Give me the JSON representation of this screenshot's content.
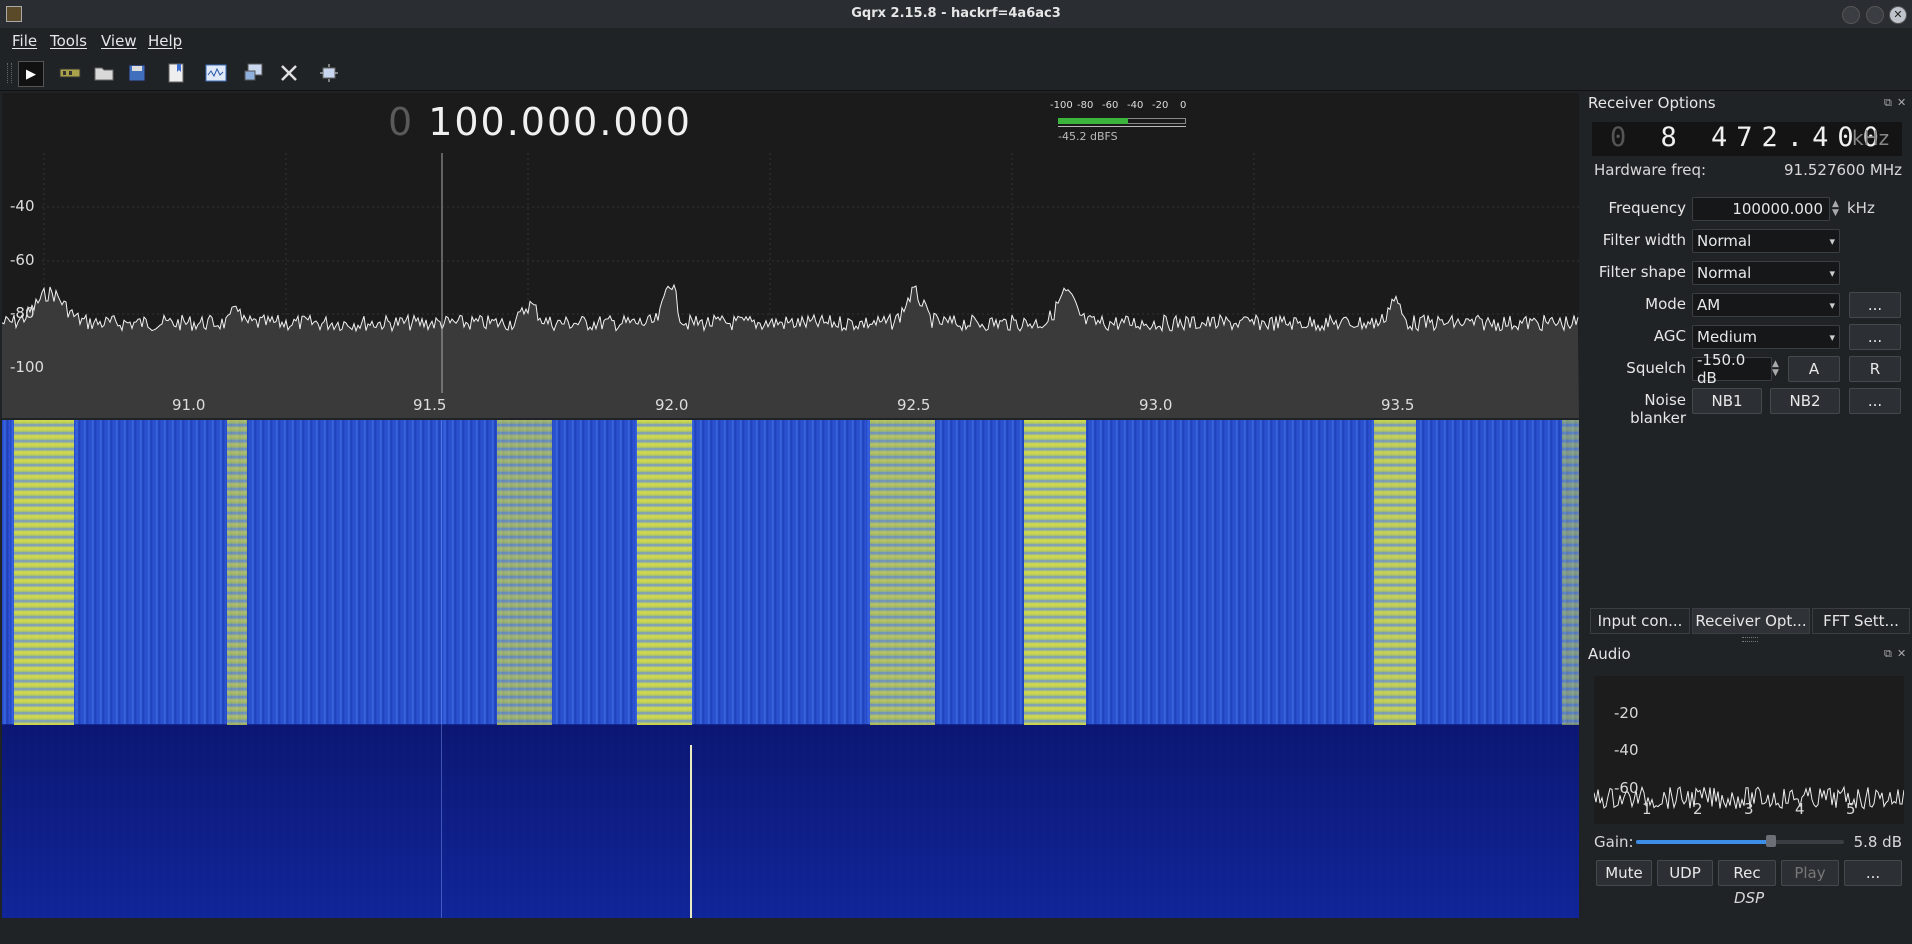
{
  "window": {
    "title": "Gqrx 2.15.8 - hackrf=4a6ac3",
    "close_glyph": "✕"
  },
  "menu": [
    "File",
    "Tools",
    "View",
    "Help"
  ],
  "toolbar": {
    "play_glyph": "▶",
    "icons": [
      "play-icon",
      "hardware-icon",
      "open-icon",
      "save-icon",
      "bookmark-icon",
      "fft-icon",
      "remote-icon",
      "settings-icon",
      "fullscreen-icon"
    ]
  },
  "plot": {
    "freq_lead": "0",
    "freq_main": "100.000.000",
    "y_labels": [
      "-40",
      "-60",
      "-80",
      "-100"
    ],
    "x_labels": [
      "91.0",
      "91.5",
      "92.0",
      "92.5",
      "93.0",
      "93.5"
    ],
    "meter_ticks": [
      "-100",
      "-80",
      "-60",
      "-40",
      "-20",
      "0"
    ],
    "meter_readout": "-45.2 dBFS",
    "meter_level": -45.2
  },
  "receiver": {
    "title": "Receiver Options",
    "float_glyph": "⧉",
    "close_glyph": "✕",
    "lcd_lead": "0",
    "lcd_digits": "8 472.400",
    "lcd_unit": "kHz",
    "hw_freq_label": "Hardware freq:",
    "hw_freq_value": "91.527600 MHz",
    "frequency_label": "Frequency",
    "frequency_value": "100000.000",
    "frequency_unit": "kHz",
    "filter_width_label": "Filter width",
    "filter_width_value": "Normal",
    "filter_shape_label": "Filter shape",
    "filter_shape_value": "Normal",
    "mode_label": "Mode",
    "mode_value": "AM",
    "agc_label": "AGC",
    "agc_value": "Medium",
    "squelch_label": "Squelch",
    "squelch_value": "-150.0 dB",
    "squelch_a": "A",
    "squelch_r": "R",
    "noise_label": "Noise blanker",
    "nb1": "NB1",
    "nb2": "NB2",
    "more": "...",
    "spin_up": "▲",
    "spin_down": "▼"
  },
  "tabs": [
    "Input con...",
    "Receiver Opt...",
    "FFT Sett..."
  ],
  "audio": {
    "title": "Audio",
    "y_labels": [
      "-20",
      "-40",
      "-60"
    ],
    "x_labels": [
      "1",
      "2",
      "3",
      "4",
      "5"
    ],
    "gain_label": "Gain:",
    "gain_value": "5.8 dB",
    "gain_fraction": 0.65,
    "buttons": [
      "Mute",
      "UDP",
      "Rec",
      "Play",
      "..."
    ],
    "dsp_label": "DSP"
  }
}
